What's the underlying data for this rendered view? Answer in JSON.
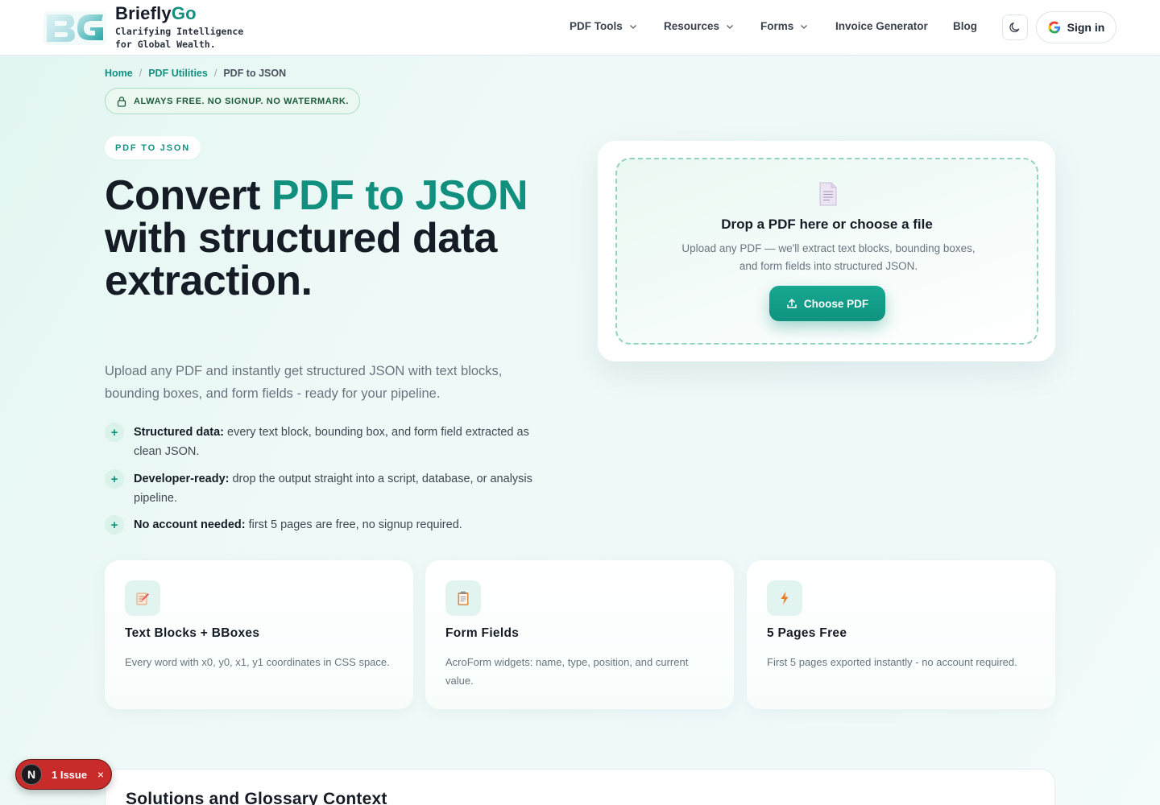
{
  "brand": {
    "name_main": "Briefly",
    "name_accent": "Go",
    "tagline_line1": "Clarifying Intelligence",
    "tagline_line2": "for Global Wealth."
  },
  "nav": {
    "items": [
      {
        "label": "PDF Tools",
        "has_dropdown": true
      },
      {
        "label": "Resources",
        "has_dropdown": true
      },
      {
        "label": "Forms",
        "has_dropdown": true
      },
      {
        "label": "Invoice Generator",
        "has_dropdown": false
      },
      {
        "label": "Blog",
        "has_dropdown": false
      }
    ],
    "theme_icon": "moon-icon",
    "signin_label": "Sign in"
  },
  "breadcrumb": {
    "home": "Home",
    "section": "PDF Utilities",
    "current": "PDF to JSON",
    "separator": "/"
  },
  "free_badge": "ALWAYS FREE. NO SIGNUP. NO WATERMARK.",
  "tool_badge": "PDF TO JSON",
  "hero": {
    "title_pre": "Convert ",
    "title_accent": "PDF to JSON",
    "title_post": " with structured data extraction.",
    "subtitle": "Upload any PDF and instantly get structured JSON with text blocks, bounding boxes, and form fields - ready for your pipeline."
  },
  "features": [
    {
      "bold": "Structured data:",
      "text": " every text block, bounding box, and form field extracted as clean JSON."
    },
    {
      "bold": "Developer-ready:",
      "text": " drop the output straight into a script, database, or analysis pipeline."
    },
    {
      "bold": "No account needed:",
      "text": " first 5 pages are free, no signup required."
    }
  ],
  "feature_marker": "+",
  "upload": {
    "title": "Drop a PDF here or choose a file",
    "description": "Upload any PDF — we'll extract text blocks, bounding boxes, and form fields into structured JSON.",
    "button_label": "Choose PDF"
  },
  "cards": [
    {
      "icon": "memo-icon",
      "title": "Text Blocks + BBoxes",
      "description": "Every word with x0, y0, x1, y1 coordinates in CSS space."
    },
    {
      "icon": "clipboard-icon",
      "title": "Form Fields",
      "description": "AcroForm widgets: name, type, position, and current value."
    },
    {
      "icon": "lightning-icon",
      "title": "5 Pages Free",
      "description": "First 5 pages exported instantly - no account required."
    }
  ],
  "solutions_title": "Solutions and Glossary Context",
  "issue_badge": {
    "letter": "N",
    "label": "1 Issue",
    "close": "×"
  },
  "colors": {
    "accent": "#12907f",
    "issue_red": "#c92a2a"
  }
}
